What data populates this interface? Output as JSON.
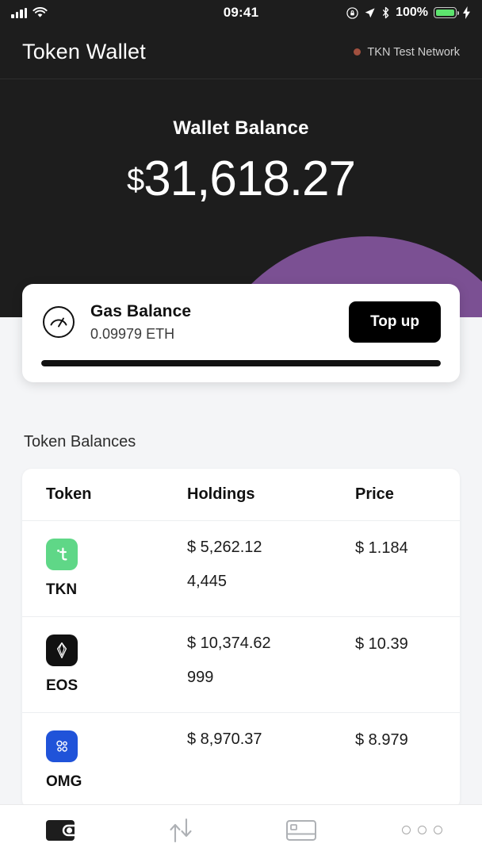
{
  "status_bar": {
    "time": "09:41",
    "battery_percent": "100%",
    "icons": [
      "signal-bars-icon",
      "wifi-icon",
      "rotation-lock-icon",
      "location-arrow-icon",
      "bluetooth-icon",
      "battery-icon",
      "charging-bolt-icon"
    ]
  },
  "header": {
    "title": "Token Wallet",
    "network_label": "TKN Test Network",
    "network_dot_color": "#a1503f"
  },
  "hero": {
    "label": "Wallet Balance",
    "currency_symbol": "$",
    "amount": "31,618.27",
    "background_color": "#1d1d1d",
    "blob_purple_color": "#7b5093",
    "blob_green_color": "#2f5d4e"
  },
  "gas_card": {
    "title": "Gas Balance",
    "amount": "0.09979 ETH",
    "topup_label": "Top up",
    "progress_percent": 100
  },
  "token_section": {
    "title": "Token Balances",
    "columns": [
      "Token",
      "Holdings",
      "Price"
    ],
    "rows": [
      {
        "symbol": "TKN",
        "icon_name": "tkn-token-icon",
        "icon_color": "#5fd787",
        "icon_glyph": "t",
        "holdings_value": "$ 5,262.12",
        "holdings_units": "4,445",
        "price": "$ 1.184"
      },
      {
        "symbol": "EOS",
        "icon_name": "eos-token-icon",
        "icon_color": "#111111",
        "icon_glyph": "eos-diamond",
        "holdings_value": "$ 10,374.62",
        "holdings_units": "999",
        "price": "$ 10.39"
      },
      {
        "symbol": "OMG",
        "icon_name": "omg-token-icon",
        "icon_color": "#2053d9",
        "icon_glyph": "omg-circles",
        "holdings_value": "$ 8,970.37",
        "holdings_units": "",
        "price": "$ 8.979"
      }
    ]
  },
  "tab_bar": {
    "tabs": [
      {
        "name": "wallet",
        "icon": "wallet-icon",
        "active": true
      },
      {
        "name": "transfer",
        "icon": "transfer-arrows-icon",
        "active": false
      },
      {
        "name": "card",
        "icon": "card-icon",
        "active": false
      },
      {
        "name": "more",
        "icon": "more-dots-icon",
        "active": false
      }
    ]
  }
}
